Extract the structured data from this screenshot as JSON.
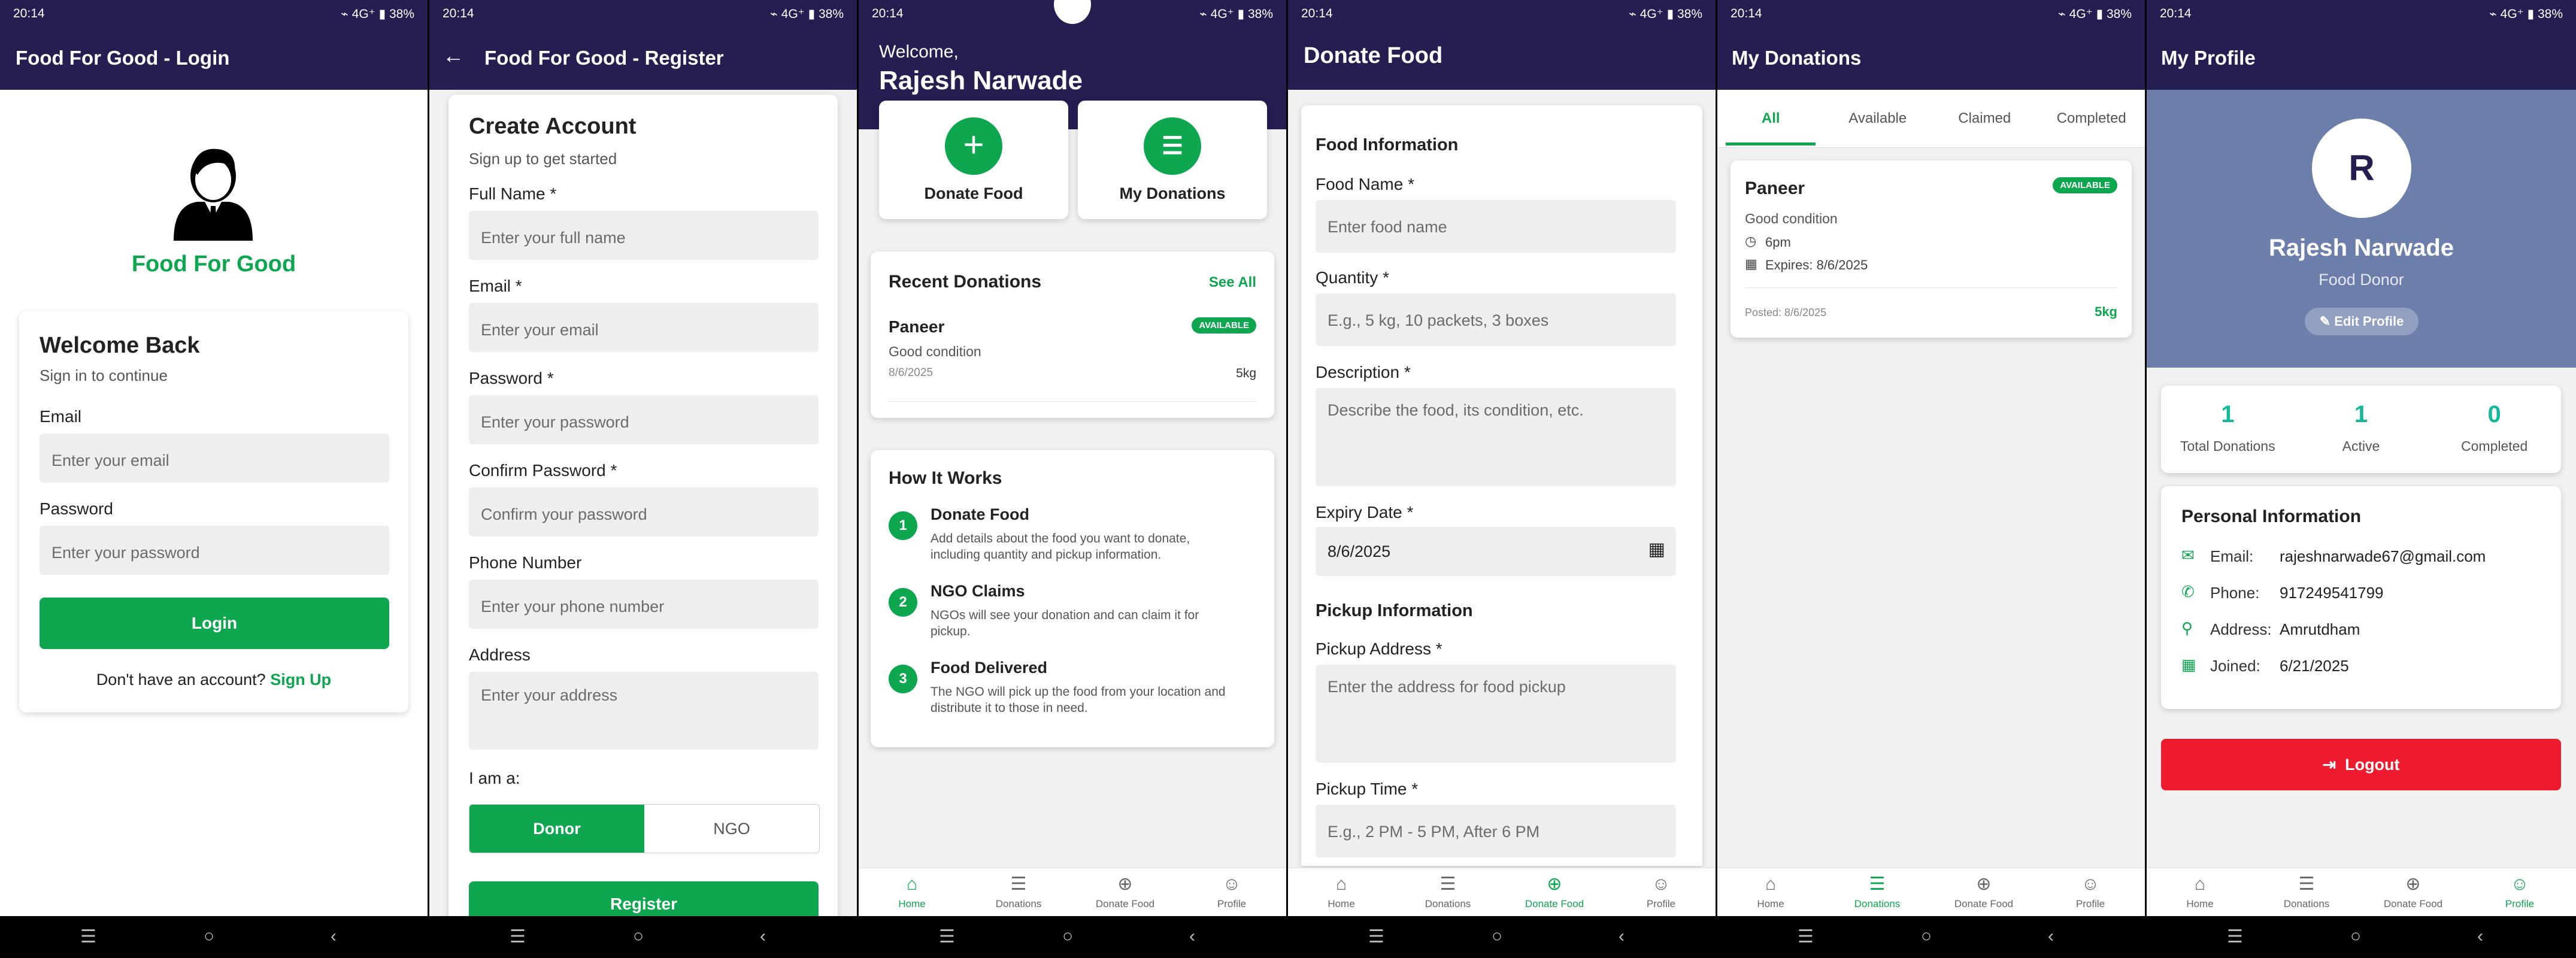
{
  "status": {
    "time": "20:14",
    "right": "⌁ 4G⁺ ▮ 38%"
  },
  "colors": {
    "header": "#251e51",
    "accent": "#0ea74f",
    "danger": "#ee1b2e",
    "profile_header": "#6c7fab"
  },
  "login": {
    "title": "Food For Good - Login",
    "brand": "Food For Good",
    "heading": "Welcome Back",
    "sub": "Sign in to continue",
    "email_label": "Email",
    "email_ph": "Enter your email",
    "password_label": "Password",
    "password_ph": "Enter your password",
    "login_btn": "Login",
    "no_account": "Don't have an account?",
    "signup": "Sign Up"
  },
  "register": {
    "title": "Food For Good - Register",
    "heading": "Create Account",
    "sub": "Sign up to get started",
    "fields": [
      {
        "label": "Full Name *",
        "ph": "Enter your full name"
      },
      {
        "label": "Email *",
        "ph": "Enter your email"
      },
      {
        "label": "Password *",
        "ph": "Enter your password"
      },
      {
        "label": "Confirm Password *",
        "ph": "Confirm your password"
      },
      {
        "label": "Phone Number",
        "ph": "Enter your phone number"
      },
      {
        "label": "Address",
        "ph": "Enter your address"
      }
    ],
    "iam": "I am a:",
    "donor": "Donor",
    "ngo": "NGO",
    "register_btn": "Register"
  },
  "home": {
    "welcome": "Welcome,",
    "name": "Rajesh Narwade",
    "donate_food": "Donate Food",
    "my_donations": "My Donations",
    "recent_title": "Recent Donations",
    "see_all": "See All",
    "recent": {
      "name": "Paneer",
      "badge": "AVAILABLE",
      "condition": "Good condition",
      "date": "8/6/2025",
      "qty": "5kg"
    },
    "how_title": "How It Works",
    "steps": [
      {
        "n": "1",
        "title": "Donate Food",
        "desc": "Add details about the food you want to donate, including quantity and pickup information."
      },
      {
        "n": "2",
        "title": "NGO Claims",
        "desc": "NGOs will see your donation and can claim it for pickup."
      },
      {
        "n": "3",
        "title": "Food Delivered",
        "desc": "The NGO will pick up the food from your location and distribute it to those in need."
      }
    ]
  },
  "donate": {
    "title": "Donate Food",
    "section1": "Food Information",
    "food_name_label": "Food Name *",
    "food_name_ph": "Enter food name",
    "qty_label": "Quantity *",
    "qty_ph": "E.g., 5 kg, 10 packets, 3 boxes",
    "desc_label": "Description *",
    "desc_ph": "Describe the food, its condition, etc.",
    "expiry_label": "Expiry Date *",
    "expiry_value": "8/6/2025",
    "section2": "Pickup Information",
    "addr_label": "Pickup Address *",
    "addr_ph": "Enter the address for food pickup",
    "time_label": "Pickup Time *",
    "time_ph": "E.g., 2 PM - 5 PM, After 6 PM"
  },
  "mydonations": {
    "title": "My Donations",
    "tabs": [
      "All",
      "Available",
      "Claimed",
      "Completed"
    ],
    "item": {
      "name": "Paneer",
      "badge": "AVAILABLE",
      "condition": "Good condition",
      "time": "6pm",
      "expires": "Expires: 8/6/2025",
      "posted": "Posted: 8/6/2025",
      "qty": "5kg"
    }
  },
  "profile": {
    "title": "My Profile",
    "initial": "R",
    "name": "Rajesh Narwade",
    "role": "Food Donor",
    "edit": "Edit Profile",
    "stats": [
      {
        "v": "1",
        "l": "Total Donations"
      },
      {
        "v": "1",
        "l": "Active"
      },
      {
        "v": "0",
        "l": "Completed"
      }
    ],
    "info_title": "Personal Information",
    "info": [
      {
        "k": "Email:",
        "v": "rajeshnarwade67@gmail.com",
        "icon": "mail-icon"
      },
      {
        "k": "Phone:",
        "v": "917249541799",
        "icon": "phone-icon"
      },
      {
        "k": "Address:",
        "v": "Amrutdham",
        "icon": "location-icon"
      },
      {
        "k": "Joined:",
        "v": "6/21/2025",
        "icon": "calendar-icon"
      }
    ],
    "logout": "Logout"
  },
  "nav": {
    "home": "Home",
    "donations": "Donations",
    "donate": "Donate Food",
    "profile": "Profile"
  }
}
